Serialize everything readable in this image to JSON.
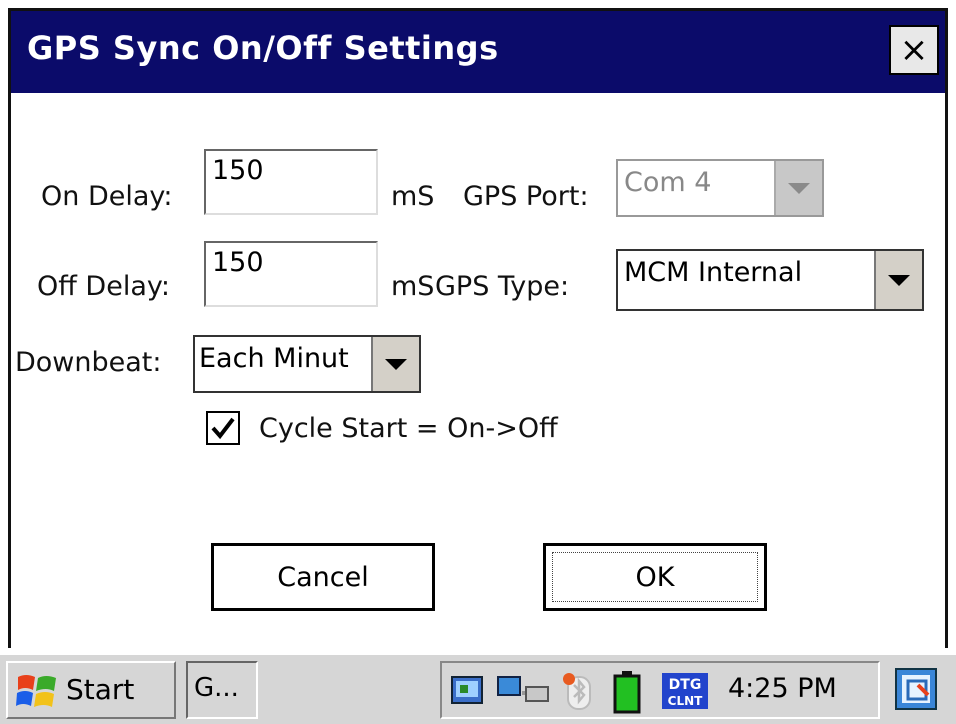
{
  "dialog": {
    "title": "GPS Sync On/Off Settings",
    "close_label": "×"
  },
  "form": {
    "on_delay_label": "On Delay:",
    "on_delay_value": "150",
    "on_delay_unit": "mS",
    "off_delay_label": "Off Delay:",
    "off_delay_value": "150",
    "off_delay_unit": "mS",
    "gps_port_label": "GPS Port:",
    "gps_port_value": "Com 4",
    "gps_type_label": "GPS Type:",
    "gps_type_value": "MCM Internal",
    "downbeat_label": "Downbeat:",
    "downbeat_value": "Each Minut",
    "cycle_start_label": "Cycle Start = On->Off",
    "cycle_start_checked": true
  },
  "buttons": {
    "cancel": "Cancel",
    "ok": "OK"
  },
  "taskbar": {
    "start_label": "Start",
    "task_item_label": "G...",
    "clock": "4:25 PM",
    "tray_icons": [
      "network-icon",
      "activesync-icon",
      "bluetooth-icon",
      "battery-icon",
      "dtg-client-icon"
    ]
  },
  "colors": {
    "titlebar": "#0b0b6a",
    "battery": "#22c022"
  }
}
